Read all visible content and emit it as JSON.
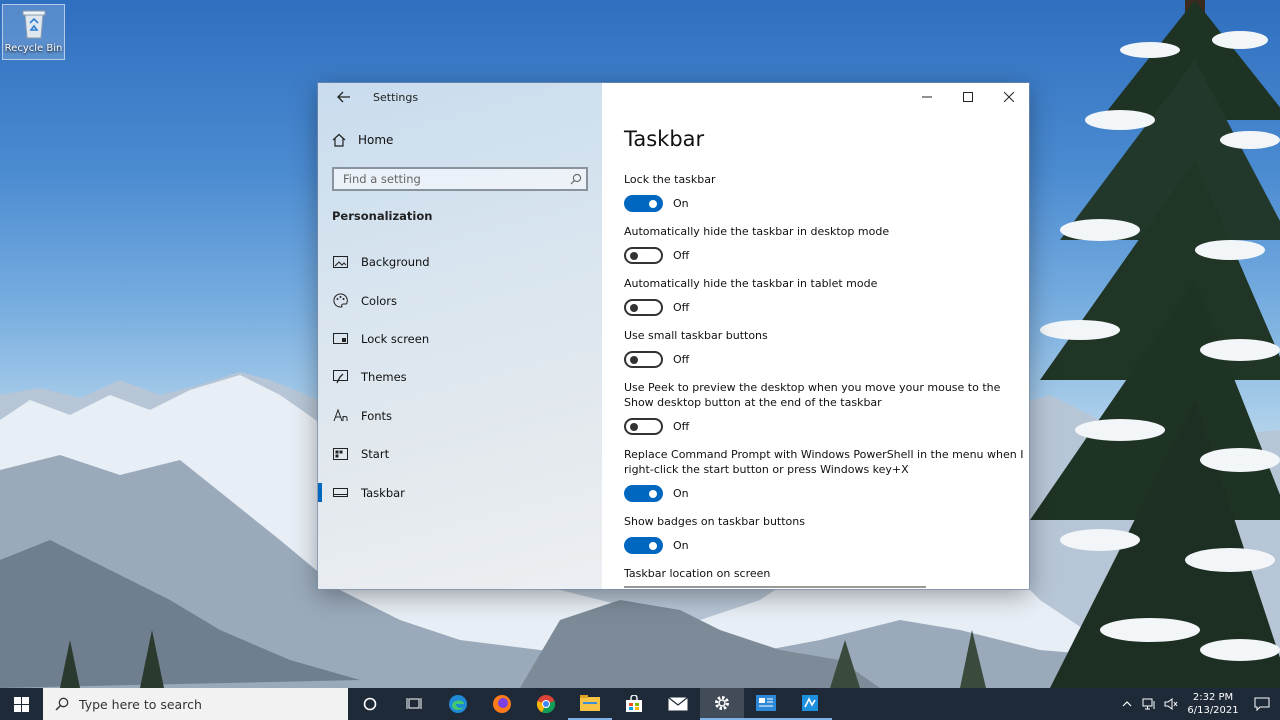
{
  "desktop": {
    "recycle_bin_label": "Recycle Bin"
  },
  "window": {
    "title": "Settings",
    "nav": {
      "home_label": "Home",
      "search_placeholder": "Find a setting",
      "section": "Personalization",
      "items": [
        {
          "label": "Background",
          "icon": "image-icon",
          "selected": false
        },
        {
          "label": "Colors",
          "icon": "palette-icon",
          "selected": false
        },
        {
          "label": "Lock screen",
          "icon": "lock-screen-icon",
          "selected": false
        },
        {
          "label": "Themes",
          "icon": "brush-icon",
          "selected": false
        },
        {
          "label": "Fonts",
          "icon": "font-icon",
          "selected": false
        },
        {
          "label": "Start",
          "icon": "start-tiles-icon",
          "selected": false
        },
        {
          "label": "Taskbar",
          "icon": "taskbar-icon",
          "selected": true
        }
      ]
    },
    "content": {
      "title": "Taskbar",
      "settings": [
        {
          "label": "Lock the taskbar",
          "state": "On"
        },
        {
          "label": "Automatically hide the taskbar in desktop mode",
          "state": "Off"
        },
        {
          "label": "Automatically hide the taskbar in tablet mode",
          "state": "Off"
        },
        {
          "label": "Use small taskbar buttons",
          "state": "Off"
        },
        {
          "label": "Use Peek to preview the desktop when you move your mouse to the Show desktop button at the end of the taskbar",
          "state": "Off"
        },
        {
          "label": "Replace Command Prompt with Windows PowerShell in the menu when I right-click the start button or press Windows key+X",
          "state": "On"
        },
        {
          "label": "Show badges on taskbar buttons",
          "state": "On"
        }
      ],
      "location_label": "Taskbar location on screen"
    },
    "accent_color": "#0067c0"
  },
  "taskbar": {
    "search_placeholder": "Type here to search",
    "apps": [
      "cortana-icon",
      "task-view-icon",
      "edge-icon",
      "firefox-icon",
      "chrome-icon",
      "file-explorer-icon",
      "store-icon",
      "mail-icon",
      "settings-icon",
      "app-icon-1",
      "app-icon-2"
    ],
    "clock": {
      "time": "2:32 PM",
      "date": "6/13/2021"
    }
  }
}
